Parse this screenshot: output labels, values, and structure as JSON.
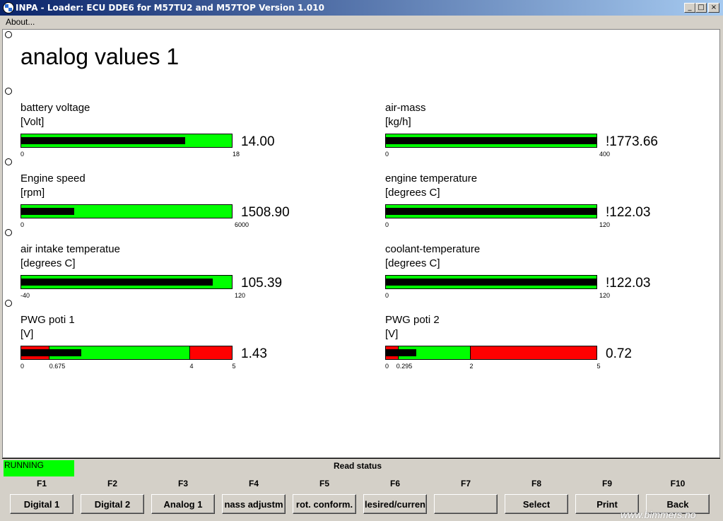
{
  "window": {
    "title": "INPA - Loader:  ECU DDE6 for M57TU2 and M57TOP Version 1.010",
    "minimize_glyph": "_",
    "maximize_glyph": "□",
    "close_glyph": "×"
  },
  "menu": {
    "about": "About..."
  },
  "page": {
    "title": "analog values 1"
  },
  "gauges": [
    {
      "label": "battery voltage",
      "unit": "[Volt]",
      "value": "14.00",
      "min": "0",
      "max": "18",
      "fill_fraction": 0.78
    },
    {
      "label": "air-mass",
      "unit": "[kg/h]",
      "value": "!1773.66",
      "min": "0",
      "max": "400",
      "fill_fraction": 1.0
    },
    {
      "label": "Engine speed",
      "unit": "[rpm]",
      "value": "1508.90",
      "min": "0",
      "max": "6000",
      "fill_fraction": 0.25
    },
    {
      "label": "engine temperature",
      "unit": "[degrees C]",
      "value": "!122.03",
      "min": "0",
      "max": "120",
      "fill_fraction": 1.0
    },
    {
      "label": "air intake temperatue",
      "unit": "[degrees C]",
      "value": "105.39",
      "min": "-40",
      "max": "120",
      "fill_fraction": 0.91
    },
    {
      "label": "coolant-temperature",
      "unit": "[degrees C]",
      "value": "!122.03",
      "min": "0",
      "max": "120",
      "fill_fraction": 1.0
    },
    {
      "label": "PWG poti 1",
      "unit": "[V]",
      "value": "1.43",
      "min": "0",
      "max": "5",
      "threshold_low": "0.675",
      "threshold_high": "4",
      "fill_fraction": 0.286,
      "low_fraction": 0.135,
      "high_fraction": 0.8
    },
    {
      "label": "PWG poti 2",
      "unit": "[V]",
      "value": "0.72",
      "min": "0",
      "max": "5",
      "threshold_low": "0.295",
      "threshold_high": "2",
      "fill_fraction": 0.144,
      "low_fraction": 0.059,
      "high_fraction": 0.4
    }
  ],
  "status": {
    "running": "RUNNING",
    "read_status": "Read status",
    "running_color": "#00ff00"
  },
  "fkeys": [
    {
      "key": "F1",
      "label": "Digital 1"
    },
    {
      "key": "F2",
      "label": "Digital 2"
    },
    {
      "key": "F3",
      "label": "Analog 1"
    },
    {
      "key": "F4",
      "label": "nass adjustm"
    },
    {
      "key": "F5",
      "label": "rot. conform."
    },
    {
      "key": "F6",
      "label": "lesired/curren"
    },
    {
      "key": "F7",
      "label": ""
    },
    {
      "key": "F8",
      "label": "Select"
    },
    {
      "key": "F9",
      "label": "Print"
    },
    {
      "key": "F10",
      "label": "Back"
    }
  ],
  "watermark": "www.bimmers.no",
  "colors": {
    "bar_ok": "#00ff00",
    "bar_alarm": "#ff0000",
    "titlebar": "#0a246a"
  }
}
